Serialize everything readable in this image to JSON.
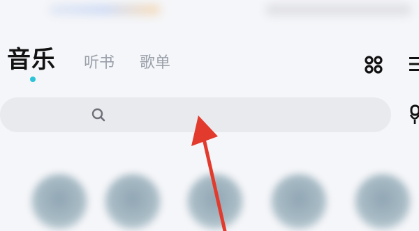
{
  "tabs": {
    "active": "音乐",
    "items": [
      "听书",
      "歌单"
    ]
  },
  "icons": {
    "grid": "grid-four-dots-icon",
    "menu": "menu-icon",
    "search": "search-icon",
    "side": "microphone-icon",
    "annotation": "red-arrow-annotation"
  },
  "colors": {
    "accent": "#2ec4d8",
    "annotation": "#e23b2e"
  },
  "recommendations": {
    "count_visible": 5
  }
}
